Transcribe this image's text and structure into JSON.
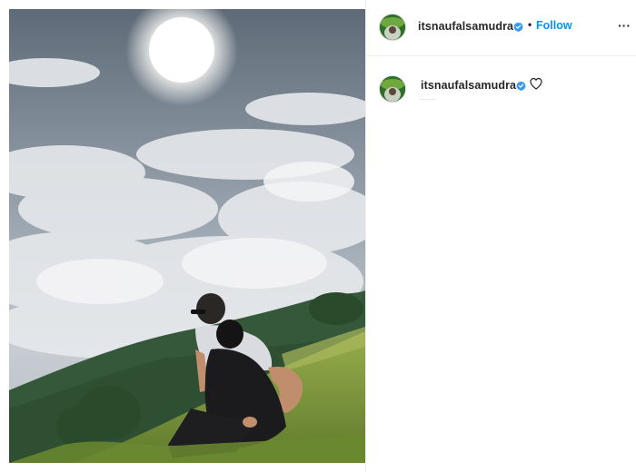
{
  "post": {
    "image": {
      "description_icon": "photo-image",
      "colors": {
        "sky_top": "#5f6a76",
        "sky_mid": "#9aa5b0",
        "cloud": "#e9ecef",
        "sun": "#ffffff",
        "hill_far": "#3c5f3c",
        "hill_near": "#6f8f3a",
        "grass": "#8aa346"
      }
    },
    "header": {
      "username": "itsnaufalsamudra",
      "verified_icon": "verified-badge-icon",
      "separator": "•",
      "follow_label": "Follow",
      "more_icon": "more-options-icon",
      "more_label": "···"
    },
    "comment": {
      "username": "itsnaufalsamudra",
      "verified_icon": "verified-badge-icon",
      "like_icon": "heart-outline-icon"
    },
    "accent_color": "#0095f6"
  }
}
